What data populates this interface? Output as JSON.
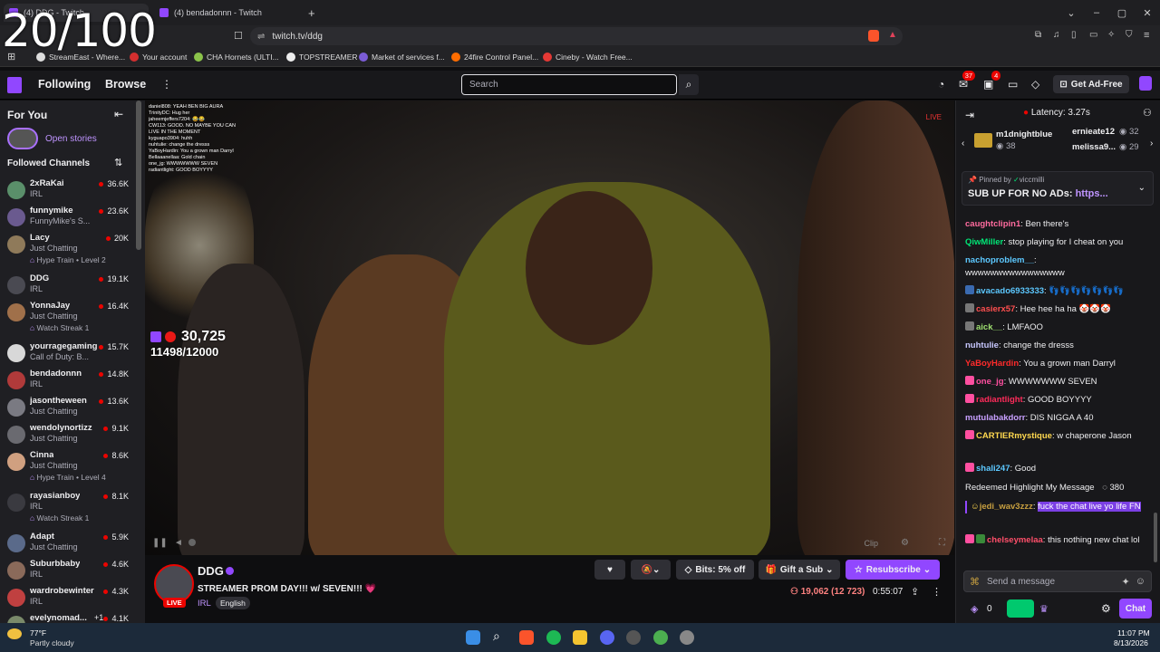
{
  "browser": {
    "tabs": [
      {
        "label": "(4) DDG - Twitch"
      },
      {
        "label": "(4) bendadonnn - Twitch"
      }
    ],
    "new_tab": "+",
    "url": "twitch.tv/ddg",
    "bookmarks": [
      "StreamEast - Where...",
      "Your account",
      "CHA Hornets (ULTI...",
      "TOPSTREAMER",
      "Market of services f...",
      "24fire Control Panel...",
      "Cineby - Watch Free..."
    ]
  },
  "overlay_counter": "20/100",
  "nav": {
    "following": "Following",
    "browse": "Browse",
    "more": "⋮",
    "search_placeholder": "Search",
    "badge_notifications": "37",
    "badge_inbox": "4",
    "get_ad_free": "Get Ad-Free"
  },
  "sidebar": {
    "for_you": "For You",
    "open_stories": "Open stories",
    "followed_channels": "Followed Channels",
    "channels": [
      {
        "name": "2xRaKai",
        "game": "IRL",
        "viewers": "36.6K",
        "color": "#5a8f6a"
      },
      {
        "name": "funnymike",
        "game": "FunnyMike's S...",
        "viewers": "23.6K",
        "color": "#6a5a8f"
      },
      {
        "name": "Lacy",
        "game": "Just Chatting",
        "extra": "Hype Train • Level 2",
        "viewers": "20K",
        "color": "#8f7a5a"
      },
      {
        "name": "DDG",
        "game": "IRL",
        "viewers": "19.1K",
        "color": "#4a4a52"
      },
      {
        "name": "YonnaJay",
        "game": "Just Chatting",
        "extra": "Watch Streak 1",
        "viewers": "16.4K",
        "color": "#a0704a"
      },
      {
        "name": "yourragegaming",
        "game": "Call of Duty: B...",
        "viewers": "15.7K",
        "color": "#d8d8d8"
      },
      {
        "name": "bendadonnn",
        "game": "IRL",
        "viewers": "14.8K",
        "color": "#b03a3a"
      },
      {
        "name": "jasontheween",
        "game": "Just Chatting",
        "viewers": "13.6K",
        "color": "#7a7a82"
      },
      {
        "name": "wendolynortizz",
        "game": "Just Chatting",
        "viewers": "9.1K",
        "color": "#6a6a70"
      },
      {
        "name": "Cinna",
        "game": "Just Chatting",
        "extra": "Hype Train • Level 4",
        "viewers": "8.6K",
        "color": "#d0a080"
      },
      {
        "name": "rayasianboy",
        "game": "IRL",
        "extra": "Watch Streak 1",
        "viewers": "8.1K",
        "color": "#3a3a40"
      },
      {
        "name": "Adapt",
        "game": "Just Chatting",
        "viewers": "5.9K",
        "color": "#5a6a8a"
      },
      {
        "name": "Suburbbaby",
        "game": "IRL",
        "viewers": "4.6K",
        "color": "#8a6a5a"
      },
      {
        "name": "wardrobewinter",
        "game": "IRL",
        "viewers": "4.3K",
        "color": "#c04040"
      },
      {
        "name": "evelynomad...",
        "game": "IRL",
        "plus": "+1",
        "viewers": "4.1K",
        "color": "#7a8a6a"
      }
    ]
  },
  "video": {
    "live_label": "LIVE",
    "sub_goal_count": "30,725",
    "sub_goal_progress": "11498/12000",
    "clip": "Clip",
    "overlay_chat": [
      "daniel808: YEAH BEN BIG AURA",
      "TrinityDC: Hug her",
      "jaheemjeffers7204: 😂😂",
      "CW113: GOOD. NO MAYBE YOU CAN",
      "LIVE IN THE MOMENT",
      "kyguapo3904: huhh",
      "nuhtulie: change the dresss",
      "YaBoyHardin: You a grown man Darryl",
      "Bellaaanellaa: Gold chain",
      "one_jg: WWWWWWW SEVEN",
      "radiantlight: GOOD BOYYYY"
    ]
  },
  "stream": {
    "channel": "DDG",
    "title": "STREAMER PROM DAY!!! w/ SEVEN!!! 💗",
    "category": "IRL",
    "tag": "English",
    "live": "LIVE",
    "bits": "Bits: 5% off",
    "gift": "Gift a Sub",
    "resub": "Resubscribe",
    "viewers": "19,062 (12 723)",
    "uptime": "0:55:07"
  },
  "chat": {
    "latency": "Latency: 3.27s",
    "leaders": [
      {
        "name": "m1dnightblue",
        "count": "38"
      },
      {
        "name": "ernieate12",
        "count": "32"
      },
      {
        "name": "melissa9...",
        "count": "29"
      }
    ],
    "pinned_by": "Pinned by",
    "pinned_user": "viccmilli",
    "pinned_text": "SUB UP FOR NO ADs: ",
    "pinned_link": "https...",
    "messages": [
      {
        "user": "caughtclipin1",
        "text": ": Ben there's",
        "color": "#ff6b9e"
      },
      {
        "user": "QiwMiller",
        "text": ": stop playing for I cheat on you",
        "color": "#00e676"
      },
      {
        "user": "nachoproblem__",
        "text": ":",
        "color": "#5cc8ff"
      },
      {
        "user": "",
        "text": "wwwwwwwwwwwwwwww",
        "color": "#efeff1"
      },
      {
        "user": "avacado6933333",
        "text": ": 👣👣👣👣👣👣👣",
        "color": "#5cc8ff"
      },
      {
        "user": "casierx57",
        "text": ": Hee hee ha ha 🤡🤡🤡",
        "color": "#ff4f4f"
      },
      {
        "user": "aick__",
        "text": ": LMFAOO",
        "color": "#9fe070"
      },
      {
        "user": "nuhtulie",
        "text": ": change the dresss",
        "color": "#c8c8ff"
      },
      {
        "user": "YaBoyHardin",
        "text": ": You a grown man Darryl",
        "color": "#ff2b2b"
      },
      {
        "user": "one_jg",
        "text": ": WWWWWWW SEVEN",
        "color": "#ff4fa0"
      },
      {
        "user": "radiantlight",
        "text": ": GOOD BOYYYY",
        "color": "#ff2b5a"
      },
      {
        "user": "mutulabakdorr",
        "text": ": DIS NIGGA A 40",
        "color": "#c8a0ff"
      },
      {
        "user": "CARTIERmystique",
        "text": ": w chaperone Jason",
        "color": "#ffd84f"
      },
      {
        "user": "shali247",
        "text": ": Good",
        "color": "#5cc8ff"
      }
    ],
    "redeemed": "Redeemed Highlight My Message",
    "redeemed_cost": "380",
    "highlight_user": "jedi_wav3zzz",
    "highlight_text": "fuck the chat live yo life FN",
    "last_user": "chelseymelaa",
    "last_text": ": this nothing new chat lol",
    "input_placeholder": "Send a message",
    "points": "0",
    "chat_button": "Chat"
  },
  "taskbar": {
    "temp": "77°F",
    "weather": "Partly cloudy",
    "time": "11:07 PM",
    "date": "8/13/2026"
  }
}
